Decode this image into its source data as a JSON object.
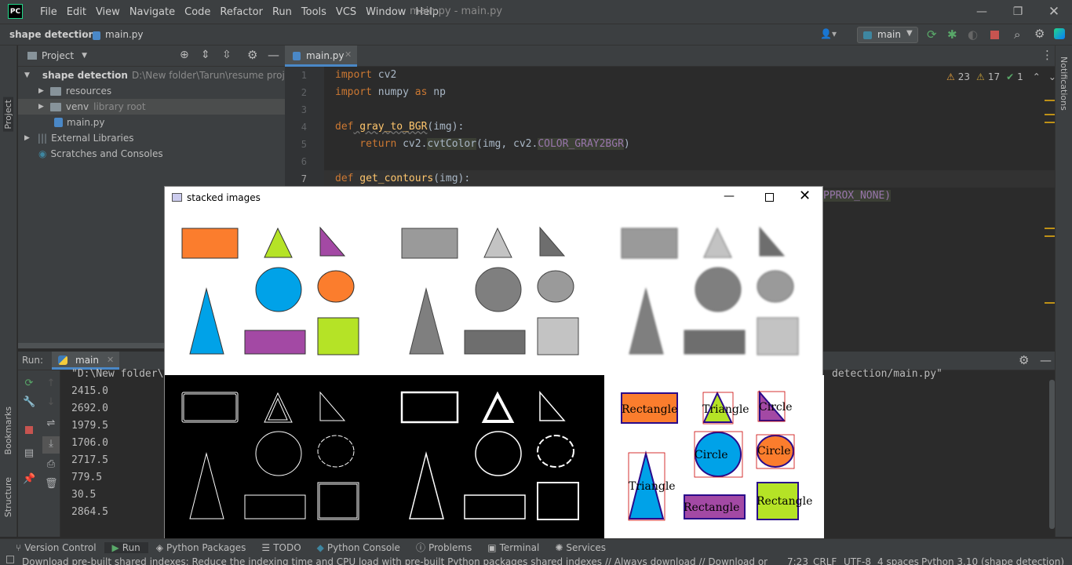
{
  "app": {
    "logo": "PC",
    "window_title": "main.py - main.py"
  },
  "menu": [
    "File",
    "Edit",
    "View",
    "Navigate",
    "Code",
    "Refactor",
    "Run",
    "Tools",
    "VCS",
    "Window",
    "Help"
  ],
  "nav": {
    "project": "shape detection",
    "file": "main.py",
    "run_config": "main"
  },
  "project_panel": {
    "title": "Project",
    "root": "shape detection",
    "root_path": "D:\\New folder\\Tarun\\resume projects\\",
    "items": [
      {
        "label": "resources",
        "note": ""
      },
      {
        "label": "venv",
        "note": "library root"
      },
      {
        "label": "main.py",
        "note": ""
      },
      {
        "label": "External Libraries",
        "note": ""
      },
      {
        "label": "Scratches and Consoles",
        "note": ""
      }
    ]
  },
  "editor": {
    "tab": "main.py",
    "warnings": "23",
    "weak_warnings": "17",
    "typos": "1",
    "lines": [
      "1",
      "2",
      "3",
      "4",
      "5",
      "6",
      "7"
    ],
    "code": {
      "l1a": "import",
      "l1b": " cv2",
      "l2a": "import",
      "l2b": " numpy ",
      "l2c": "as",
      "l2d": " np",
      "l4a": "def",
      "l4b": " gray_to_BGR",
      "l4c": "(img):",
      "l5a": "    return",
      "l5b": " cv2.",
      "l5c": "cvtColor",
      "l5d": "(img, cv2.",
      "l5e": "COLOR_GRAY2BGR",
      "l5f": ")",
      "l7a": "def",
      "l7b": " get_contours",
      "l7c": "(img):",
      "l8": "PPROX_NONE)"
    }
  },
  "run": {
    "label": "Run:",
    "config": "main",
    "command_left": "\"D:\\New folder\\",
    "command_right": "detection/main.py\"",
    "output": [
      "2415.0",
      "2692.0",
      "1979.5",
      "1706.0",
      "2717.5",
      "779.5",
      "30.5",
      "2864.5"
    ]
  },
  "cv_window": {
    "title": "stacked images",
    "labels": {
      "rect1": "Rectangle",
      "tri1": "Triangle",
      "circ1": "Circle",
      "circ2": "Circle",
      "circ3": "Circle",
      "tri2": "Triangle",
      "rect2": "Rectangle",
      "rect3": "Rectangle"
    }
  },
  "left_vertical": {
    "project": "Project",
    "bookmarks": "Bookmarks",
    "structure": "Structure"
  },
  "right_vertical": {
    "notifications": "Notifications"
  },
  "bottom_tabs": [
    "Version Control",
    "Run",
    "Python Packages",
    "TODO",
    "Python Console",
    "Problems",
    "Terminal",
    "Services"
  ],
  "status": {
    "message": "Download pre-built shared indexes: Reduce the indexing time and CPU load with pre-built Python packages shared indexes // Always download // Download on... (moments ago)",
    "position": "7:23",
    "line_sep": "CRLF",
    "encoding": "UTF-8",
    "indent": "4 spaces",
    "interpreter": "Python 3.10 (shape detection)"
  },
  "colors": {
    "orange": "#fb7d2d",
    "green": "#b5e326",
    "purple": "#a349a4",
    "blue": "#00a2e8",
    "gray": "#7f7f7f",
    "light_gray": "#c3c3c3",
    "mid_gray": "#9a9a9a"
  }
}
